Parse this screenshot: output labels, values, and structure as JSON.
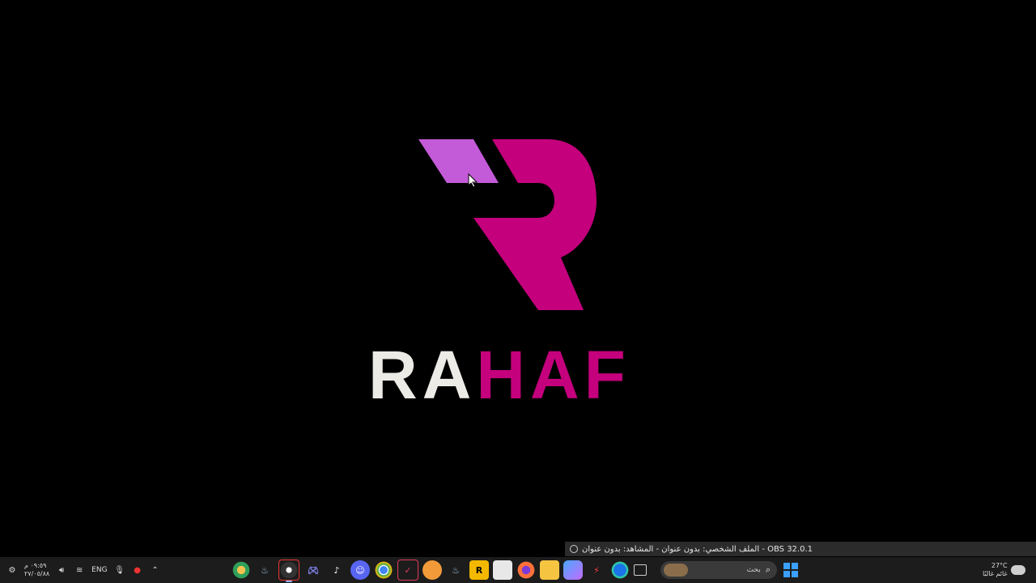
{
  "brand": {
    "part1": "RA",
    "part2": "HAF"
  },
  "colors": {
    "magenta": "#c4007d",
    "light_purple": "#c35ad8",
    "off_white": "#ecebe6",
    "background": "#000000"
  },
  "obs_tooltip": {
    "title": "الملف الشخصي: بدون عنوان - المشاهد: بدون عنوان - OBS 32.0.1"
  },
  "taskbar": {
    "clock": {
      "time": "٠٩:٥٩ م",
      "date": "٢٧/٠٥/٨٨"
    },
    "language": "ENG",
    "search": {
      "placeholder": "بحث"
    },
    "weather": {
      "temp": "27°C",
      "desc": "غائم غالبًا"
    },
    "apps": [
      "chrome-canary-icon",
      "steam-icon",
      "obs-icon",
      "controller-icon",
      "tiktok-icon",
      "discord-icon",
      "chrome-icon",
      "capcut-icon",
      "arc-icon",
      "steam-icon",
      "rockstar-icon",
      "store-icon",
      "firefox-icon",
      "file-explorer-icon",
      "copilot-icon",
      "spark-icon",
      "edge-icon",
      "task-view-icon"
    ]
  }
}
